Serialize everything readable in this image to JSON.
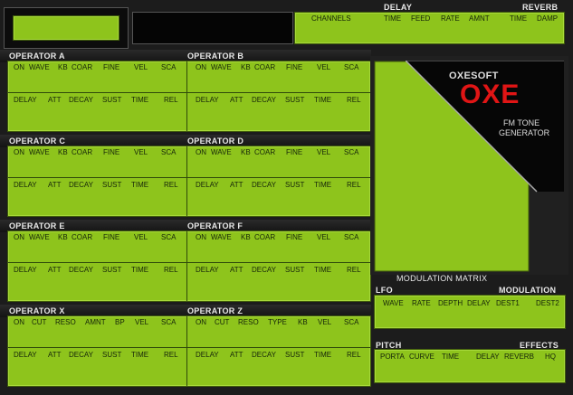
{
  "top": {
    "delay_title": "DELAY",
    "reverb_title": "REVERB",
    "delay_labels": [
      "CHANNELS",
      "TIME",
      "FEED",
      "RATE",
      "AMNT"
    ],
    "reverb_labels": [
      "TIME",
      "DAMP"
    ]
  },
  "operators": [
    {
      "title": "OPERATOR A",
      "row1": [
        "ON",
        "WAVE",
        "KB",
        "COAR",
        "FINE",
        "VEL",
        "SCA"
      ],
      "row2": [
        "DELAY",
        "ATT",
        "DECAY",
        "SUST",
        "TIME",
        "REL"
      ]
    },
    {
      "title": "OPERATOR B",
      "row1": [
        "ON",
        "WAVE",
        "KB",
        "COAR",
        "FINE",
        "VEL",
        "SCA"
      ],
      "row2": [
        "DELAY",
        "ATT",
        "DECAY",
        "SUST",
        "TIME",
        "REL"
      ]
    },
    {
      "title": "OPERATOR C",
      "row1": [
        "ON",
        "WAVE",
        "KB",
        "COAR",
        "FINE",
        "VEL",
        "SCA"
      ],
      "row2": [
        "DELAY",
        "ATT",
        "DECAY",
        "SUST",
        "TIME",
        "REL"
      ]
    },
    {
      "title": "OPERATOR D",
      "row1": [
        "ON",
        "WAVE",
        "KB",
        "COAR",
        "FINE",
        "VEL",
        "SCA"
      ],
      "row2": [
        "DELAY",
        "ATT",
        "DECAY",
        "SUST",
        "TIME",
        "REL"
      ]
    },
    {
      "title": "OPERATOR E",
      "row1": [
        "ON",
        "WAVE",
        "KB",
        "COAR",
        "FINE",
        "VEL",
        "SCA"
      ],
      "row2": [
        "DELAY",
        "ATT",
        "DECAY",
        "SUST",
        "TIME",
        "REL"
      ]
    },
    {
      "title": "OPERATOR F",
      "row1": [
        "ON",
        "WAVE",
        "KB",
        "COAR",
        "FINE",
        "VEL",
        "SCA"
      ],
      "row2": [
        "DELAY",
        "ATT",
        "DECAY",
        "SUST",
        "TIME",
        "REL"
      ]
    },
    {
      "title": "OPERATOR X",
      "row1": [
        "ON",
        "CUT",
        "RESO",
        "AMNT",
        "BP",
        "VEL",
        "SCA"
      ],
      "row2": [
        "DELAY",
        "ATT",
        "DECAY",
        "SUST",
        "TIME",
        "REL"
      ]
    },
    {
      "title": "OPERATOR Z",
      "row1": [
        "ON",
        "CUT",
        "RESO",
        "TYPE",
        "KB",
        "VEL",
        "SCA"
      ],
      "row2": [
        "DELAY",
        "ATT",
        "DECAY",
        "SUST",
        "TIME",
        "REL"
      ]
    }
  ],
  "logo": {
    "brand": "OXESOFT",
    "name": "OXE",
    "sub1": "FM TONE",
    "sub2": "GENERATOR"
  },
  "matrix_title": "MODULATION MATRIX",
  "lfo": {
    "title": "LFO",
    "mod_title": "MODULATION",
    "labels": [
      "WAVE",
      "RATE",
      "DEPTH",
      "DELAY",
      "DEST1",
      "DEST2"
    ]
  },
  "pitch": {
    "title": "PITCH",
    "fx_title": "EFFECTS",
    "labels": [
      "PORTA",
      "CURVE",
      "TIME",
      "DELAY",
      "REVERB",
      "HQ"
    ]
  }
}
